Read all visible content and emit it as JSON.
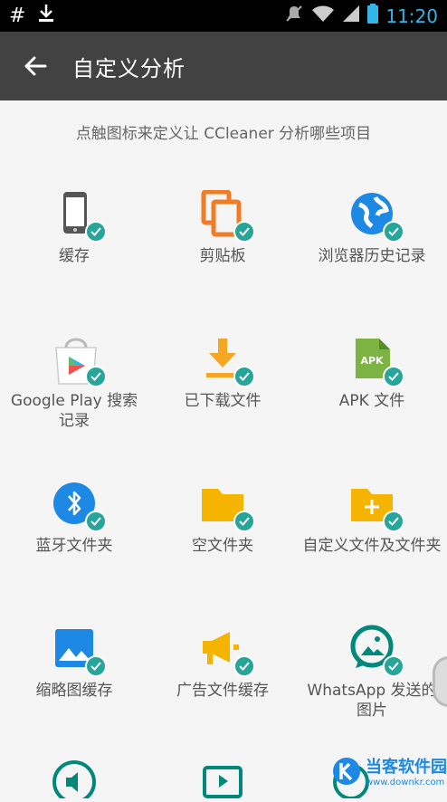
{
  "status_bar": {
    "left_icons": [
      "hash-icon",
      "download-icon"
    ],
    "right_icons": [
      "mute-icon",
      "wifi-icon",
      "signal-icon",
      "battery-icon"
    ],
    "time": "11:20"
  },
  "toolbar": {
    "title": "自定义分析"
  },
  "instruction": "点触图标来定义让 CCleaner 分析哪些项目",
  "items": [
    {
      "label": "缓存",
      "icon": "phone-icon",
      "checked": true
    },
    {
      "label": "剪贴板",
      "icon": "clipboard-icon",
      "checked": true
    },
    {
      "label": "浏览器历史记录",
      "icon": "browser-globe-icon",
      "checked": true
    },
    {
      "label": "Google Play 搜索记录",
      "icon": "google-play-icon",
      "checked": true
    },
    {
      "label": "已下载文件",
      "icon": "download-icon",
      "checked": true
    },
    {
      "label": "APK 文件",
      "icon": "apk-icon",
      "checked": true
    },
    {
      "label": "蓝牙文件夹",
      "icon": "bluetooth-icon",
      "checked": true
    },
    {
      "label": "空文件夹",
      "icon": "folder-icon",
      "checked": true
    },
    {
      "label": "自定义文件及文件夹",
      "icon": "folder-plus-icon",
      "checked": true
    },
    {
      "label": "缩略图缓存",
      "icon": "image-icon",
      "checked": true
    },
    {
      "label": "广告文件缓存",
      "icon": "megaphone-icon",
      "checked": true
    },
    {
      "label": "WhatsApp 发送的图片",
      "icon": "whatsapp-image-icon",
      "checked": true
    }
  ],
  "watermark": {
    "text": "当客软件园",
    "sub": "www.downkr.com"
  },
  "colors": {
    "check": "#26a69a",
    "toolbar": "#424242",
    "time": "#33b5e5"
  }
}
